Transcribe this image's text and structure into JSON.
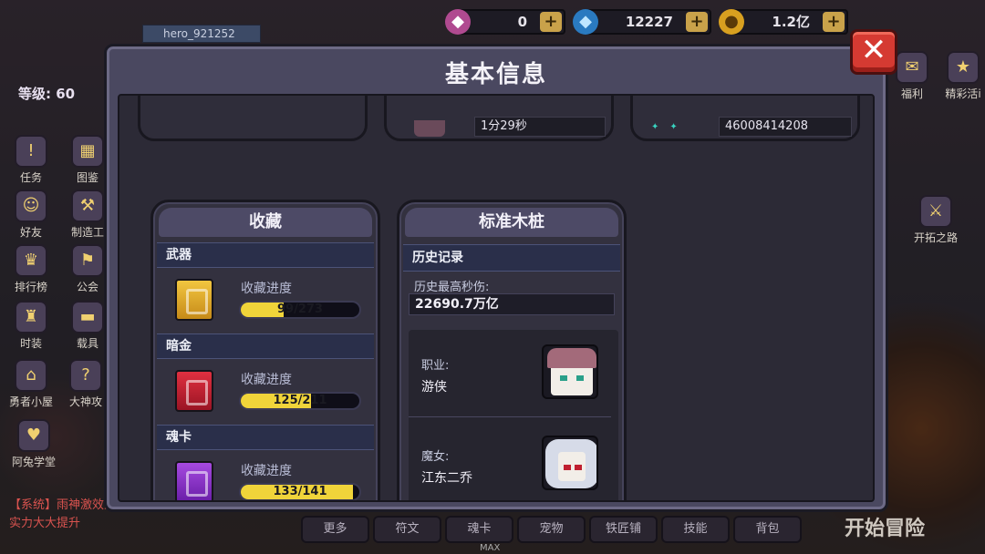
{
  "hud": {
    "username": "hero_921252",
    "level": "等级: 60",
    "currencies": [
      {
        "icon": "pink-gem-icon",
        "value": "0"
      },
      {
        "icon": "diamond-icon",
        "value": "12227"
      },
      {
        "icon": "gold-coin-icon",
        "value": "1.2亿"
      }
    ],
    "left_menu": [
      "任务",
      "图鉴",
      "好友",
      "制造工",
      "排行榜",
      "公会",
      "时装",
      "载具",
      "勇者小屋",
      "大神攻"
    ],
    "right_menu": [
      "福利",
      "精彩活i",
      "开拓之路"
    ],
    "system_message": "【系统】雨神激效果，实力大大提升",
    "school_label": "阿兔学堂",
    "bottom_tabs": [
      "更多",
      "符文",
      "魂卡",
      "宠物",
      "铁匠铺",
      "技能",
      "背包"
    ],
    "max_label": "MAX",
    "start_button": "开始冒险"
  },
  "modal": {
    "title": "基本信息",
    "close_label": "✕",
    "top_partial": {
      "time_value": "1分29秒",
      "id_value": "46008414208"
    },
    "collection": {
      "title": "收藏",
      "sections": [
        {
          "name": "武器",
          "progress_label": "收藏进度",
          "progress_text": "99/273",
          "progress_fraction": 0.363
        },
        {
          "name": "暗金",
          "progress_label": "收藏进度",
          "progress_text": "125/211",
          "progress_fraction": 0.592
        },
        {
          "name": "魂卡",
          "progress_label": "收藏进度",
          "progress_text": "133/141",
          "progress_fraction": 0.943
        }
      ]
    },
    "dummy": {
      "title": "标准木桩",
      "history_label": "历史记录",
      "max_dps_label": "历史最高秒伤:",
      "max_dps_value": "22690.7万亿",
      "class_label": "职业:",
      "class_value": "游侠",
      "witch_label": "魔女:",
      "witch_value": "江东二乔"
    }
  },
  "colors": {
    "progress_fill": "#f0d43a",
    "close_button": "#d53a32",
    "panel_bg": "#4a4860"
  }
}
